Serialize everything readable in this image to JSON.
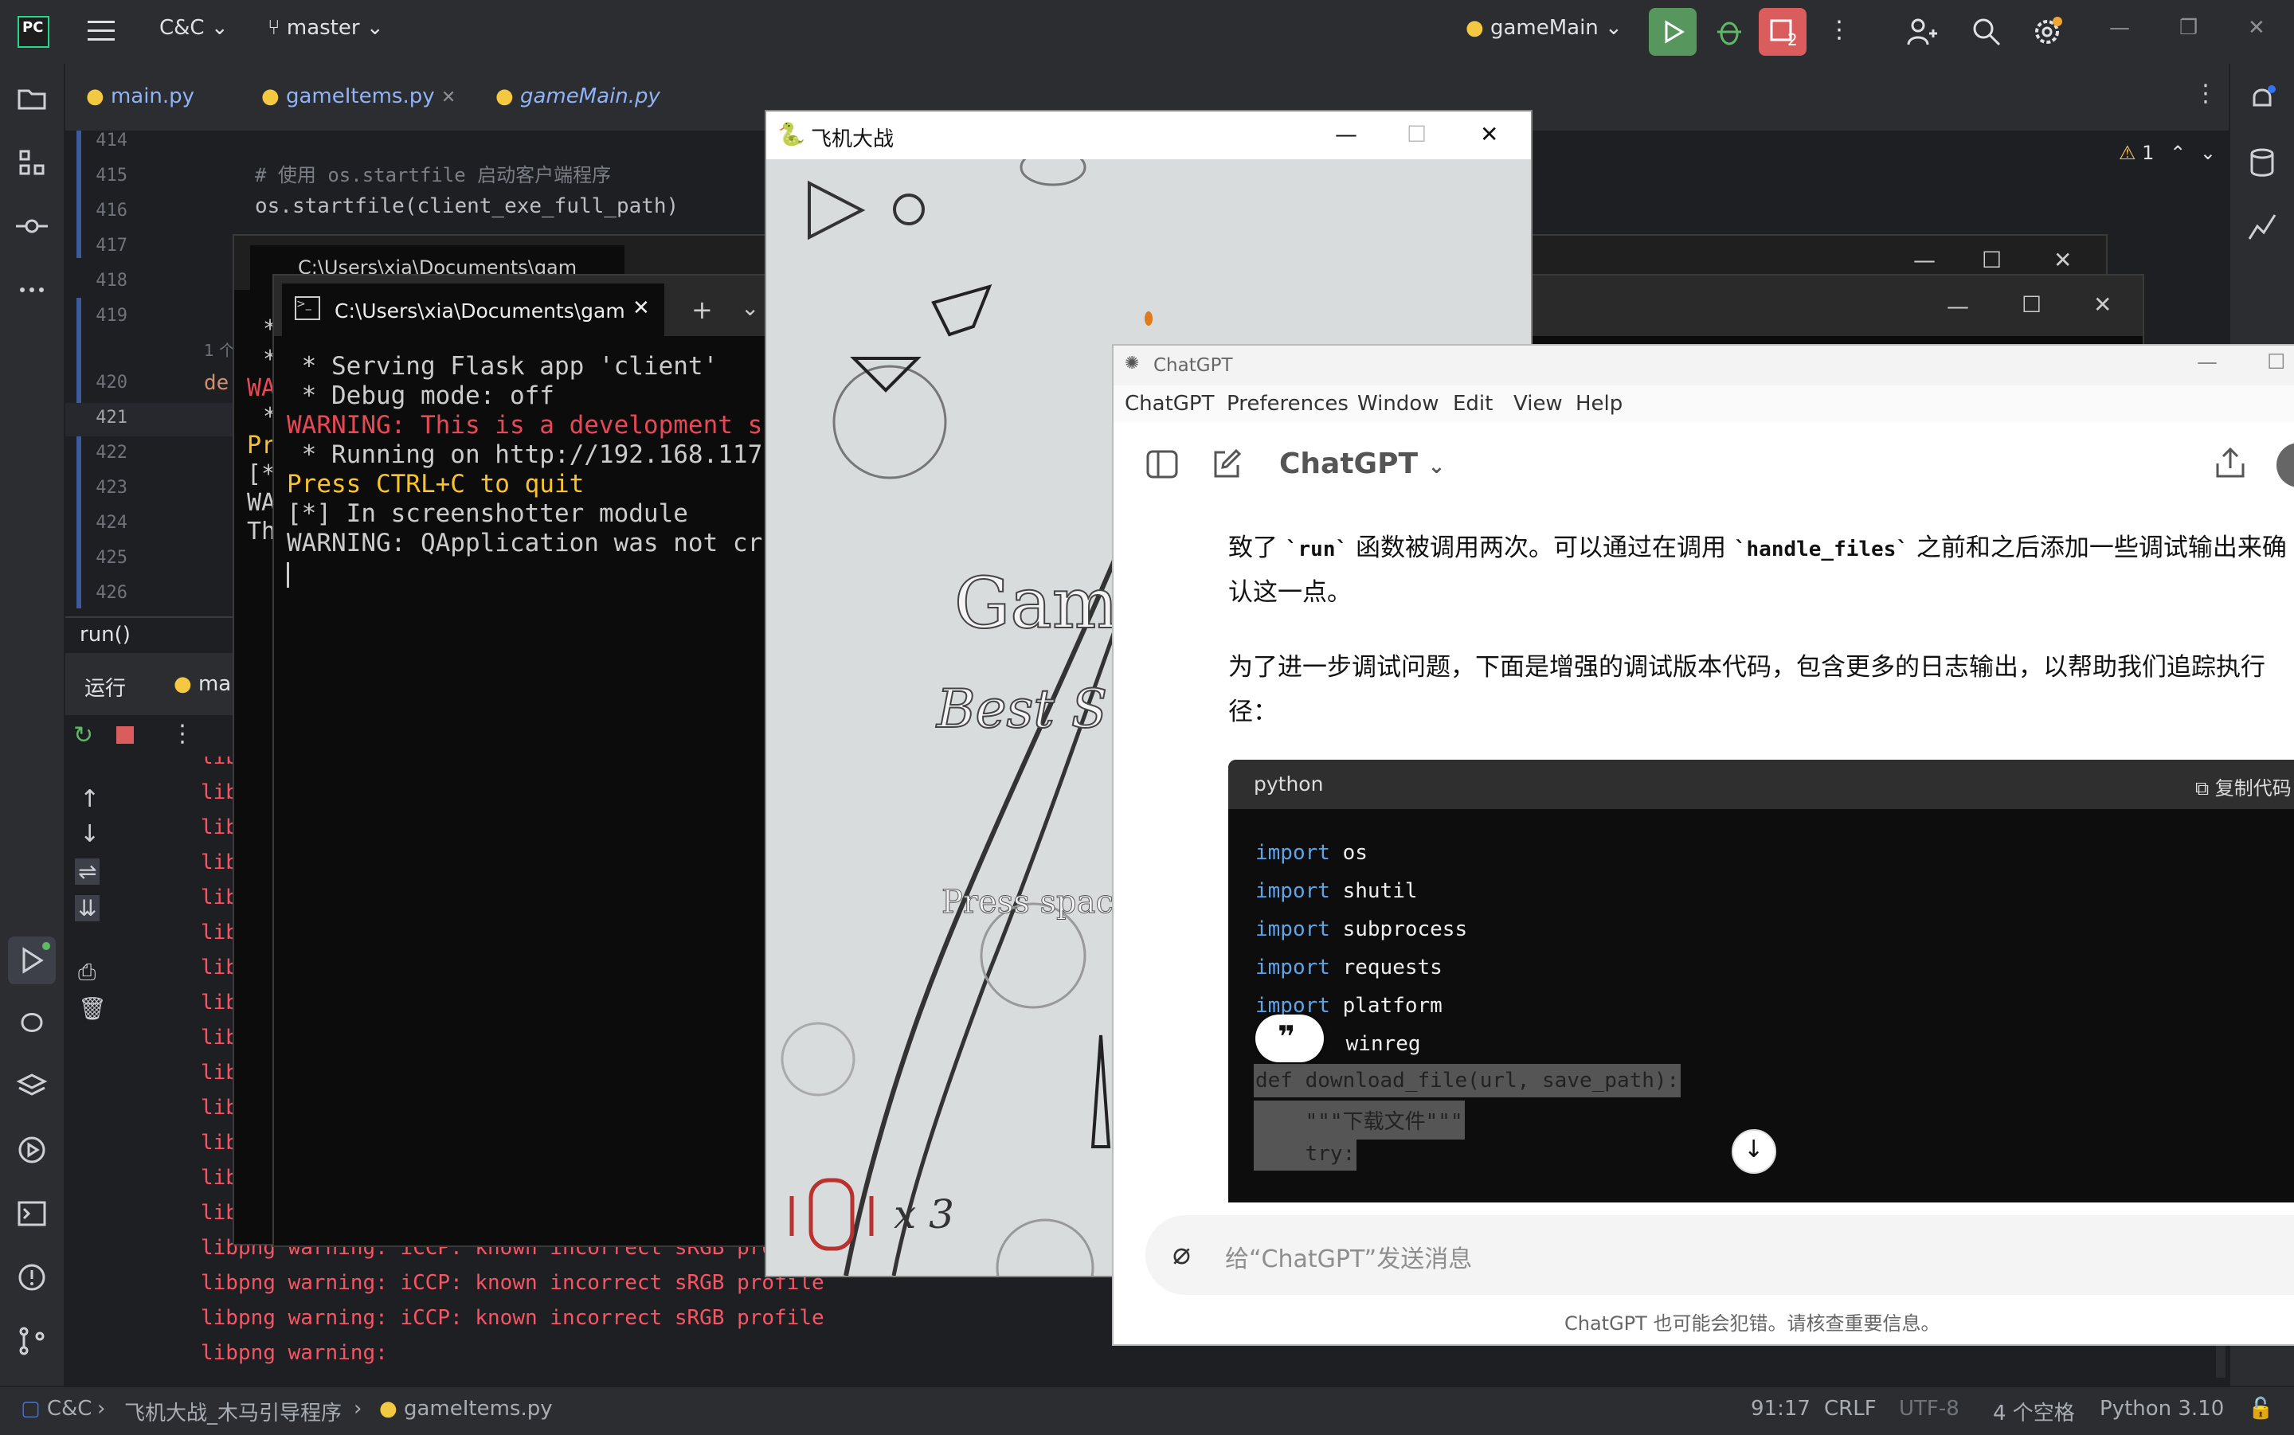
{
  "ide": {
    "project": "C&C",
    "branch": "master",
    "run_config": "gameMain",
    "problems_count": "2",
    "tabs": [
      {
        "label": "main.py"
      },
      {
        "label": "gameItems.py"
      },
      {
        "label": "gameMain.py"
      }
    ],
    "warning_count": "1",
    "line_numbers": [
      "414",
      "415",
      "416",
      "417",
      "418",
      "419",
      "420",
      "421",
      "422",
      "423",
      "424",
      "425",
      "426"
    ],
    "code": {
      "comment_line": "# 使用 os.startfile 启动客户端程序",
      "startfile_line": "os.startfile(client_exe_full_path)",
      "usage_hint": "1 个",
      "def_fragment": "de"
    },
    "breadcrumb": "run()",
    "run_tab_label": "运行",
    "run_config_tab": "ma",
    "run_output": [
      "libpng w",
      "libpng w",
      "libpng w",
      "libpng w",
      "libpng w",
      "libpng w",
      "libpng w",
      "libpng w",
      "libpng w",
      "libpng w",
      "libpng w",
      "libpng w",
      "libpng w",
      "libpng warn",
      "libpng warning: iCCP: known incorrect sRGB profile",
      "libpng warning: iCCP: known incorrect sRGB profile",
      "libpng warning: iCCP: known incorrect sRGB profile",
      "libpng warning:"
    ],
    "status": {
      "path_root": "C&C",
      "path_folder": "飞机大战_木马引导程序",
      "path_file": "gameItems.py",
      "position": "91:17",
      "line_ending": "CRLF",
      "encoding": "UTF-8",
      "indent": "4 个空格",
      "interpreter": "Python 3.10"
    }
  },
  "terminal_back": {
    "tab_title": "C:\\Users\\xia\\Documents\\gam",
    "lines": [
      "*",
      "*",
      "WA",
      "*",
      "Pr",
      "[*",
      "WA",
      "Th"
    ]
  },
  "terminal_front": {
    "tab_title": "C:\\Users\\xia\\Documents\\gam",
    "lines": [
      {
        "text": " * Serving Flask app 'client'",
        "color": "#cccccc"
      },
      {
        "text": " * Debug mode: off",
        "color": "#cccccc"
      },
      {
        "text": "WARNING: This is a development s",
        "color": "#e74856"
      },
      {
        "text": " * Running on http://192.168.117",
        "color": "#cccccc"
      },
      {
        "text": "Press CTRL+C to quit",
        "color": "#f9c32b"
      },
      {
        "text": "[*] In screenshotter module",
        "color": "#cccccc"
      },
      {
        "text": "WARNING: QApplication was not cr",
        "color": "#cccccc"
      }
    ]
  },
  "game": {
    "window_title": "飞机大战",
    "title_fragment": "Game",
    "score_fragment": "Best S",
    "prompt_fragment": "Press spac",
    "lives": "x 3"
  },
  "chatgpt": {
    "window_title": "ChatGPT",
    "menu": [
      "ChatGPT",
      "Preferences",
      "Window",
      "Edit",
      "View",
      "Help"
    ],
    "model_label": "ChatGPT",
    "para1_a": "致了 ",
    "para1_code1": "`run`",
    "para1_b": " 函数被调用两次。可以通过在调用 ",
    "para1_code2": "`handle_files`",
    "para1_c": " 之前和之后添加一些调试输出来确",
    "para1_line2": "认这一点。",
    "para2_line1": "为了进一步调试问题，下面是增强的调试版本代码，包含更多的日志输出，以帮助我们追踪执行",
    "para2_line2": "径：",
    "code_lang": "python",
    "copy_label": "复制代码",
    "imports": [
      {
        "kw": "import",
        "mod": "os"
      },
      {
        "kw": "import",
        "mod": "shutil"
      },
      {
        "kw": "import",
        "mod": "subprocess"
      },
      {
        "kw": "import",
        "mod": "requests"
      },
      {
        "kw": "import",
        "mod": "platform"
      },
      {
        "kw": "",
        "mod": "winreg"
      }
    ],
    "def_line": "def download_file(url, save_path):",
    "doc_line": "    \"\"\"下载文件\"\"\"",
    "try_line": "    try:",
    "input_placeholder": "给“ChatGPT”发送消息",
    "disclaimer": "ChatGPT 也可能会犯错。请核查重要信息。"
  },
  "colors": {
    "ide_bg": "#1e1f22",
    "ide_panel": "#2b2d30",
    "error_red": "#f75464",
    "keyword_blue": "#5aa5ec"
  }
}
